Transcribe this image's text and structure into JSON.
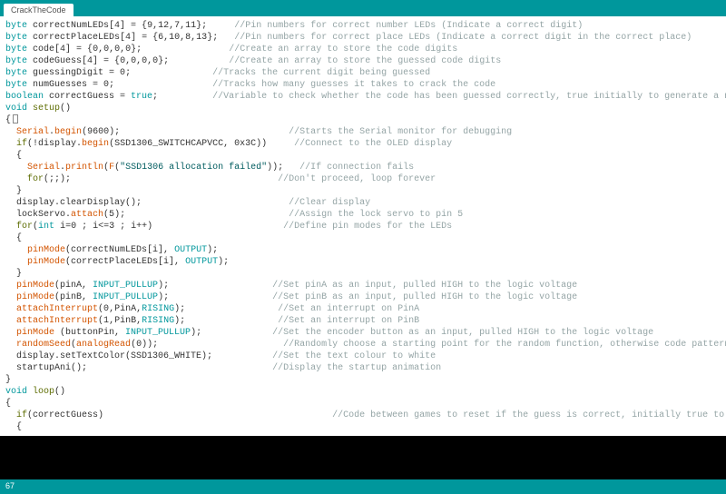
{
  "tab": {
    "label": "CrackTheCode"
  },
  "status": {
    "line": "67"
  },
  "code": {
    "l1a": "byte",
    "l1b": " correctNumLEDs[",
    "l1c": "4",
    "l1d": "] = {",
    "l1e": "9",
    "l1f": ",",
    "l1g": "12",
    "l1h": ",",
    "l1i": "7",
    "l1j": ",",
    "l1k": "11",
    "l1l": "};     ",
    "l1m": "//Pin numbers for correct number LEDs (Indicate a correct digit)",
    "l2a": "byte",
    "l2b": " correctPlaceLEDs[",
    "l2c": "4",
    "l2d": "] = {",
    "l2e": "6",
    "l2f": ",",
    "l2g": "10",
    "l2h": ",",
    "l2i": "8",
    "l2j": ",",
    "l2k": "13",
    "l2l": "};   ",
    "l2m": "//Pin numbers for correct place LEDs (Indicate a correct digit in the correct place)",
    "l3": "",
    "l4a": "byte",
    "l4b": " code[",
    "l4c": "4",
    "l4d": "] = {",
    "l4e": "0",
    "l4f": ",",
    "l4g": "0",
    "l4h": ",",
    "l4i": "0",
    "l4j": ",",
    "l4k": "0",
    "l4l": "};                ",
    "l4m": "//Create an array to store the code digits",
    "l5a": "byte",
    "l5b": " codeGuess[",
    "l5c": "4",
    "l5d": "] = {",
    "l5e": "0",
    "l5f": ",",
    "l5g": "0",
    "l5h": ",",
    "l5i": "0",
    "l5j": ",",
    "l5k": "0",
    "l5l": "};           ",
    "l5m": "//Create an array to store the guessed code digits",
    "l6a": "byte",
    "l6b": " guessingDigit = ",
    "l6c": "0",
    "l6d": ";               ",
    "l6m": "//Tracks the current digit being guessed",
    "l7a": "byte",
    "l7b": " numGuesses = ",
    "l7c": "0",
    "l7d": ";                  ",
    "l7m": "//Tracks how many guesses it takes to crack the code",
    "l8a": "boolean",
    "l8b": " correctGuess = ",
    "l8c": "true",
    "l8d": ";          ",
    "l8m": "//Variable to check whether the code has been guessed correctly, true initially to generate a new code on startup",
    "l9": "",
    "l10a": "void",
    "l10b": " ",
    "l10c": "setup",
    "l10d": "()",
    "l11": "{",
    "l12a": "  ",
    "l12b": "Serial",
    "l12c": ".",
    "l12d": "begin",
    "l12e": "(",
    "l12f": "9600",
    "l12g": ");                               ",
    "l12m": "//Starts the Serial monitor for debugging",
    "l13a": "  ",
    "l13b": "if",
    "l13c": "(!display.",
    "l13d": "begin",
    "l13e": "(SSD1306_SWITCHCAPVCC, 0x3C))     ",
    "l13m": "//Connect to the OLED display",
    "l14": "  {",
    "l15a": "    ",
    "l15b": "Serial",
    "l15c": ".",
    "l15d": "println",
    "l15e": "(",
    "l15f": "F",
    "l15g": "(",
    "l15h": "\"SSD1306 allocation failed\"",
    "l15i": "));   ",
    "l15m": "//If connection fails",
    "l16a": "    ",
    "l16b": "for",
    "l16c": "(;;);                                      ",
    "l16m": "//Don't proceed, loop forever",
    "l17": "  }",
    "l18a": "  display.clearDisplay();                           ",
    "l18m": "//Clear display",
    "l19a": "  lockServo.",
    "l19b": "attach",
    "l19c": "(",
    "l19d": "5",
    "l19e": ");                              ",
    "l19m": "//Assign the lock servo to pin 5",
    "l20a": "  ",
    "l20b": "for",
    "l20c": "(",
    "l20d": "int",
    "l20e": " i=",
    "l20f": "0",
    "l20g": " ; i<=",
    "l20h": "3",
    "l20i": " ; i++)                        ",
    "l20m": "//Define pin modes for the LEDs",
    "l21": "  {",
    "l22a": "    ",
    "l22b": "pinMode",
    "l22c": "(correctNumLEDs[i], ",
    "l22d": "OUTPUT",
    "l22e": ");",
    "l23a": "    ",
    "l23b": "pinMode",
    "l23c": "(correctPlaceLEDs[i], ",
    "l23d": "OUTPUT",
    "l23e": ");",
    "l24": "  }",
    "l25a": "  ",
    "l25b": "pinMode",
    "l25c": "(pinA, ",
    "l25d": "INPUT_PULLUP",
    "l25e": ");                   ",
    "l25m": "//Set pinA as an input, pulled HIGH to the logic voltage",
    "l26a": "  ",
    "l26b": "pinMode",
    "l26c": "(pinB, ",
    "l26d": "INPUT_PULLUP",
    "l26e": ");                   ",
    "l26m": "//Set pinB as an input, pulled HIGH to the logic voltage",
    "l27a": "  ",
    "l27b": "attachInterrupt",
    "l27c": "(",
    "l27d": "0",
    "l27e": ",PinA,",
    "l27f": "RISING",
    "l27g": ");                 ",
    "l27m": "//Set an interrupt on PinA",
    "l28a": "  ",
    "l28b": "attachInterrupt",
    "l28c": "(",
    "l28d": "1",
    "l28e": ",PinB,",
    "l28f": "RISING",
    "l28g": ");                 ",
    "l28m": "//Set an interrupt on PinB",
    "l29a": "  ",
    "l29b": "pinMode",
    "l29c": " (buttonPin, ",
    "l29d": "INPUT_PULLUP",
    "l29e": ");             ",
    "l29m": "//Set the encoder button as an input, pulled HIGH to the logic voltage",
    "l30a": "  ",
    "l30b": "randomSeed",
    "l30c": "(",
    "l30d": "analogRead",
    "l30e": "(",
    "l30f": "0",
    "l30g": "));                       ",
    "l30m": "//Randomly choose a starting point for the random function, otherwise code pattern is predictable",
    "l31a": "  display.setTextColor(SSD1306_WHITE);           ",
    "l31m": "//Set the text colour to white",
    "l32a": "  startupAni();                                  ",
    "l32m": "//Display the startup animation",
    "l33": "}",
    "l34": "",
    "l35a": "void",
    "l35b": " ",
    "l35c": "loop",
    "l35d": "()",
    "l36": "{",
    "l37a": "  ",
    "l37b": "if",
    "l37c": "(correctGuess)                                          ",
    "l37m": "//Code between games to reset if the guess is correct, initially true to open safe and then generate new code",
    "l38": "  {"
  }
}
